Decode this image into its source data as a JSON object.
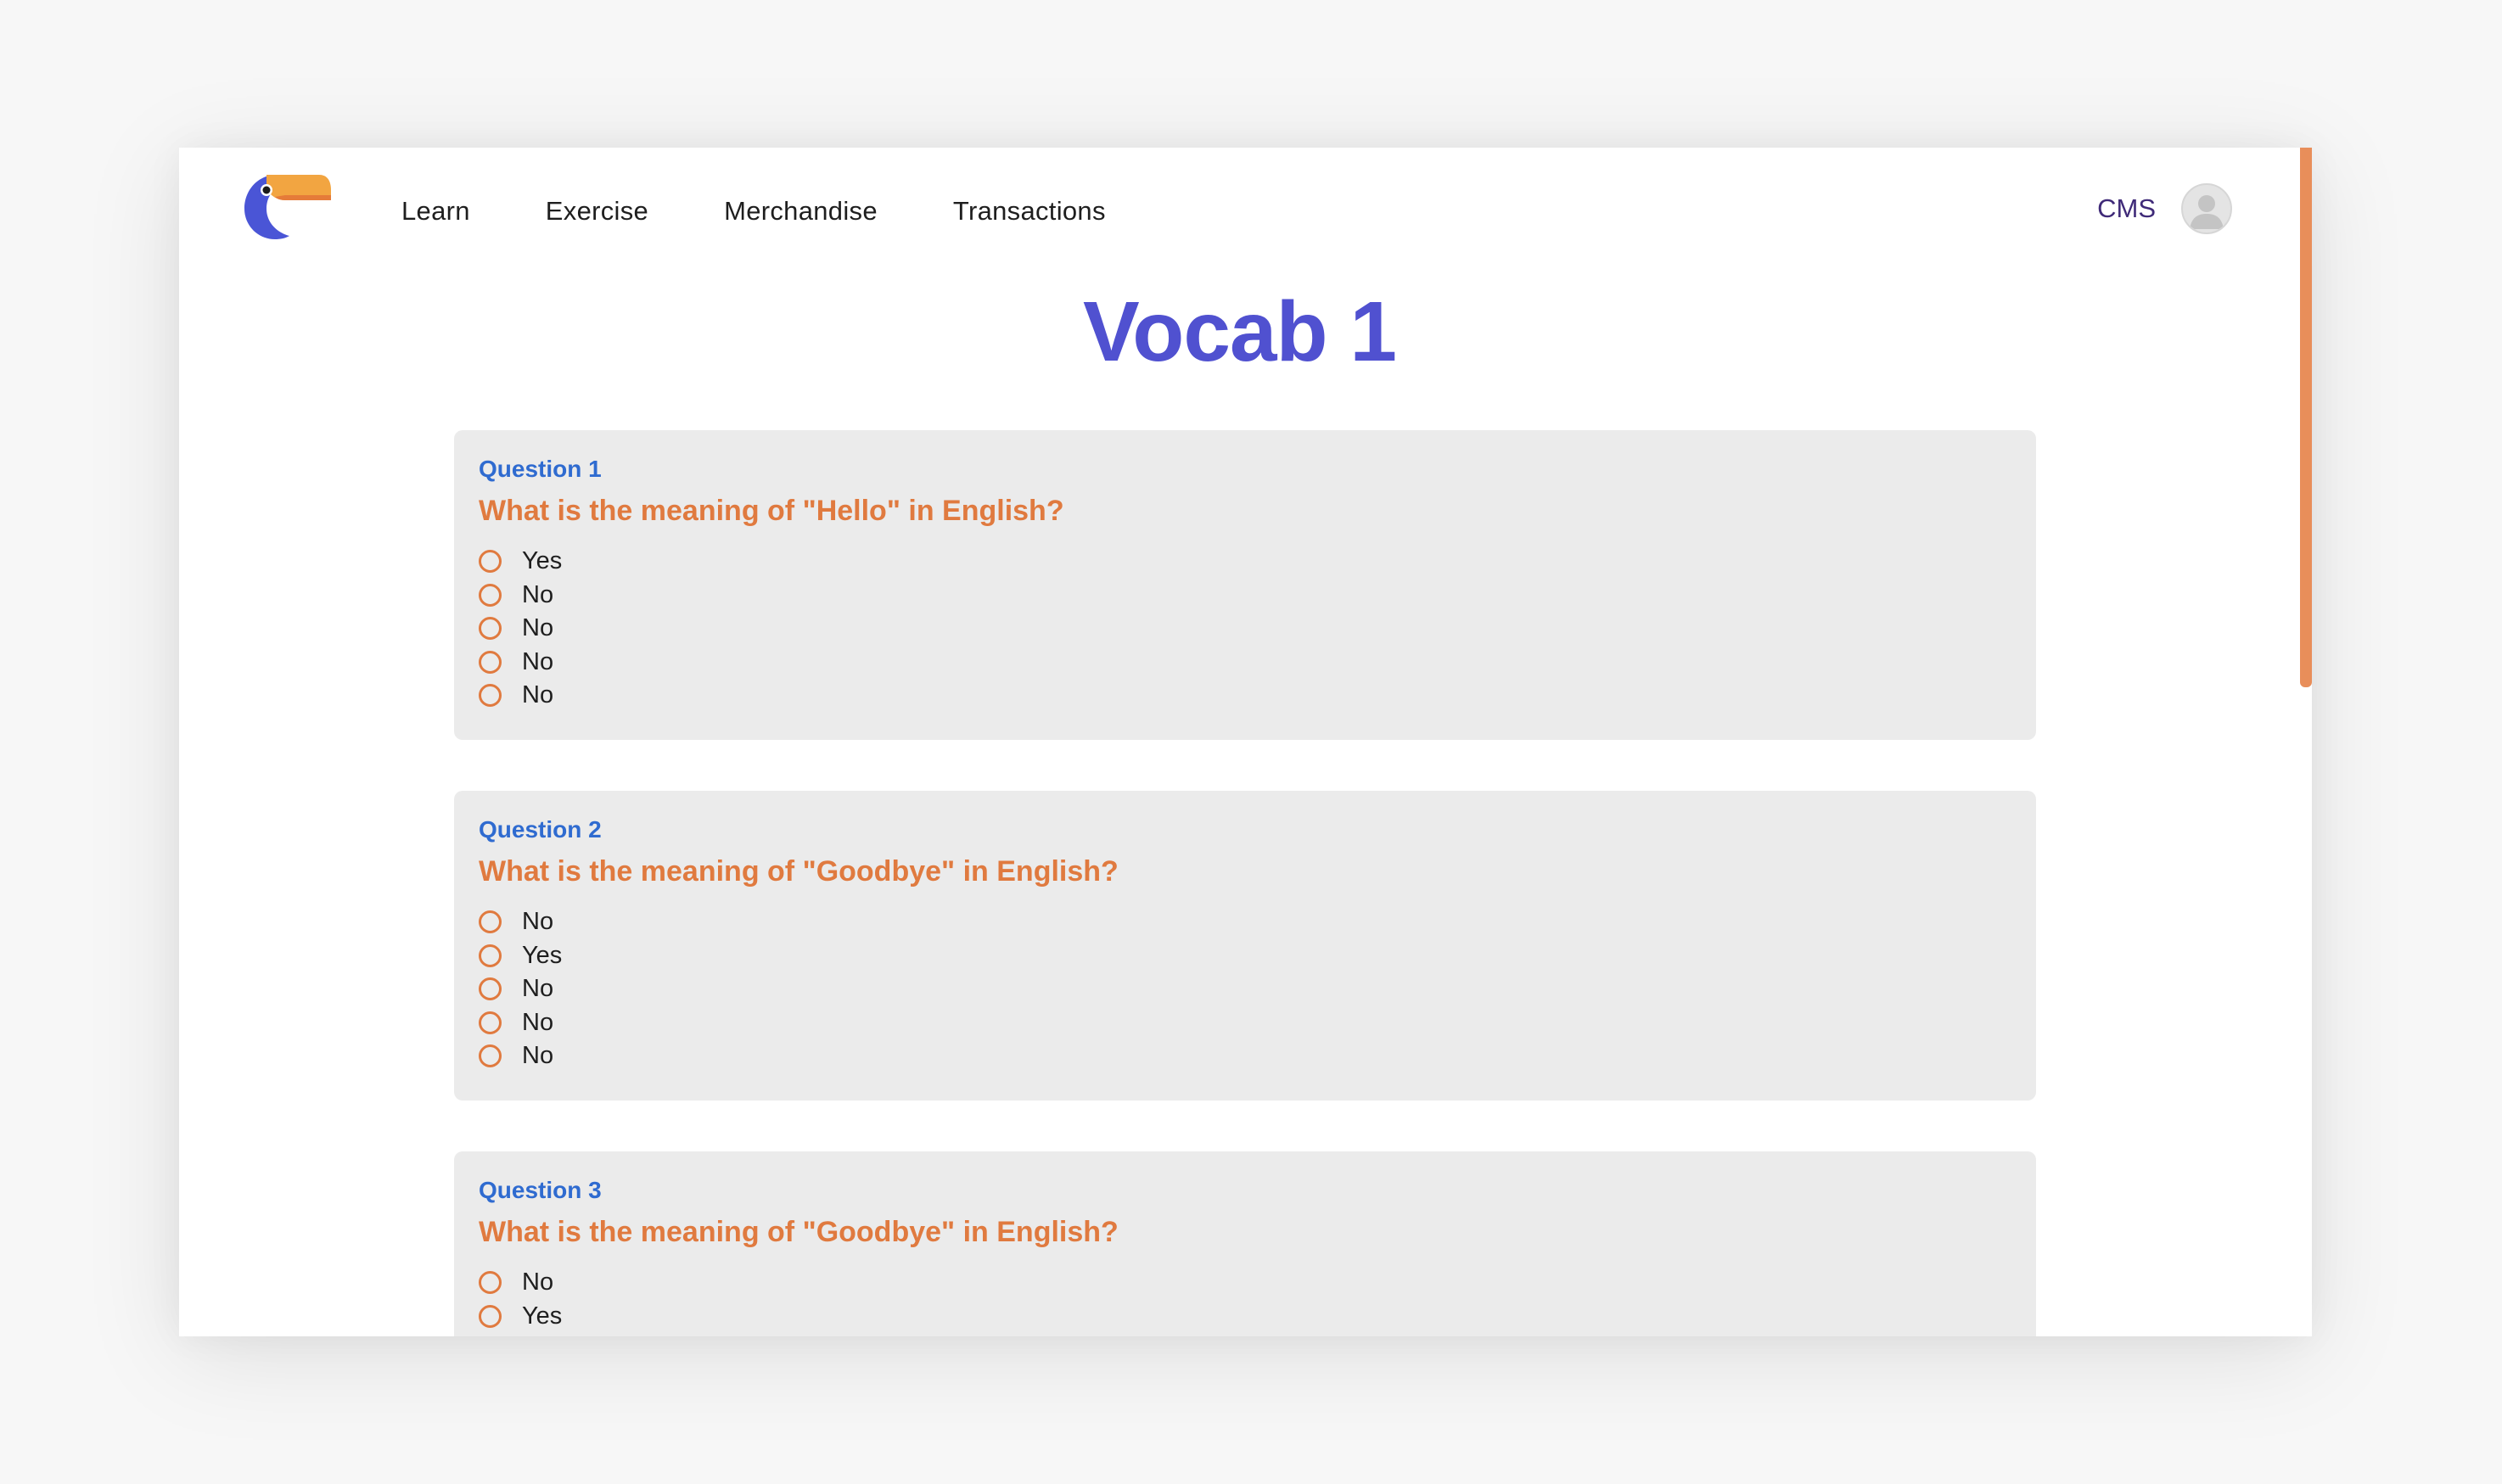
{
  "nav": {
    "links": [
      "Learn",
      "Exercise",
      "Merchandise",
      "Transactions"
    ],
    "cms_label": "CMS",
    "logo_icon": "toucan-logo-icon",
    "avatar_icon": "user-avatar-icon"
  },
  "page": {
    "title": "Vocab 1"
  },
  "questions": [
    {
      "number": "Question 1",
      "text": "What is the meaning of \"Hello\" in English?",
      "options": [
        "Yes",
        "No",
        "No",
        "No",
        "No"
      ]
    },
    {
      "number": "Question 2",
      "text": "What is the meaning of \"Goodbye\" in English?",
      "options": [
        "No",
        "Yes",
        "No",
        "No",
        "No"
      ]
    },
    {
      "number": "Question 3",
      "text": "What is the meaning of \"Goodbye\" in English?",
      "options": [
        "No",
        "Yes"
      ]
    }
  ],
  "colors": {
    "title": "#5051d0",
    "question_number": "#2f6bd0",
    "question_text": "#e07a3f",
    "scrollbar": "#e88e5a"
  }
}
